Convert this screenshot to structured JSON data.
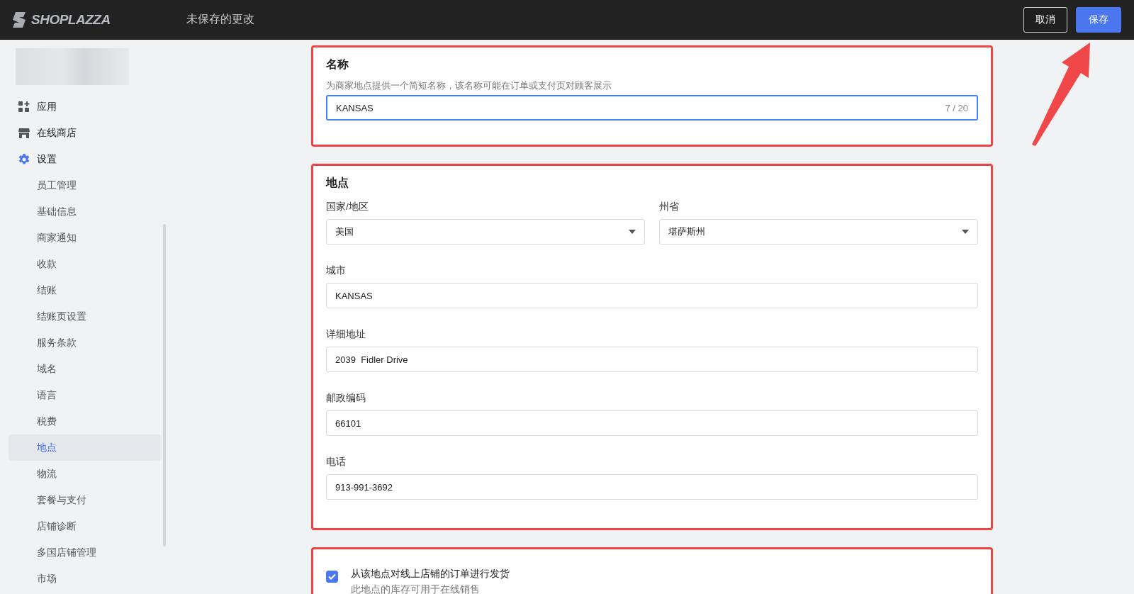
{
  "topbar": {
    "logo": "SHOPLAZZA",
    "title": "未保存的更改",
    "buttons": [
      {
        "label": "取消",
        "kind": "secondary"
      },
      {
        "label": "保存",
        "kind": "primary"
      }
    ]
  },
  "sidebar": {
    "items": [
      {
        "label": "应用",
        "selected": false
      },
      {
        "label": "在线商店",
        "selected": false
      },
      {
        "label": "设置",
        "selected": false,
        "children": [
          {
            "label": "员工管理",
            "selected": false
          },
          {
            "label": "基础信息",
            "selected": false
          },
          {
            "label": "商家通知",
            "selected": false
          },
          {
            "label": "收款",
            "selected": false
          },
          {
            "label": "结账",
            "selected": false
          },
          {
            "label": "结账页设置",
            "selected": false
          },
          {
            "label": "服务条款",
            "selected": false
          },
          {
            "label": "域名",
            "selected": false
          },
          {
            "label": "语言",
            "selected": false
          },
          {
            "label": "税费",
            "selected": false
          },
          {
            "label": "地点",
            "selected": true
          },
          {
            "label": "物流",
            "selected": false
          },
          {
            "label": "套餐与支付",
            "selected": false
          },
          {
            "label": "店铺诊断",
            "selected": false
          },
          {
            "label": "多国店铺管理",
            "selected": false
          },
          {
            "label": "市场",
            "selected": false
          }
        ]
      }
    ]
  },
  "name_card": {
    "title": "名称",
    "hint": "为商家地点提供一个简短名称，该名称可能在订单或支付页对顾客展示",
    "value": "KANSAS",
    "counter": "7 / 20"
  },
  "location_card": {
    "title": "地点",
    "fields": [
      {
        "kind": "select",
        "label": "国家/地区",
        "value": "美国"
      },
      {
        "kind": "select",
        "label": "州省",
        "value": "堪萨斯州"
      },
      {
        "kind": "text",
        "label": "城市",
        "value": "KANSAS"
      },
      {
        "kind": "text",
        "label": "详细地址",
        "value": "2039  Fidler Drive"
      },
      {
        "kind": "text",
        "label": "邮政编码",
        "value": "66101"
      },
      {
        "kind": "text",
        "label": "电话",
        "value": "913-991-3692"
      }
    ]
  },
  "fulfillment_card": {
    "checked": true,
    "label": "从该地点对线上店铺的订单进行发货",
    "description": "此地点的库存可用于在线销售"
  }
}
